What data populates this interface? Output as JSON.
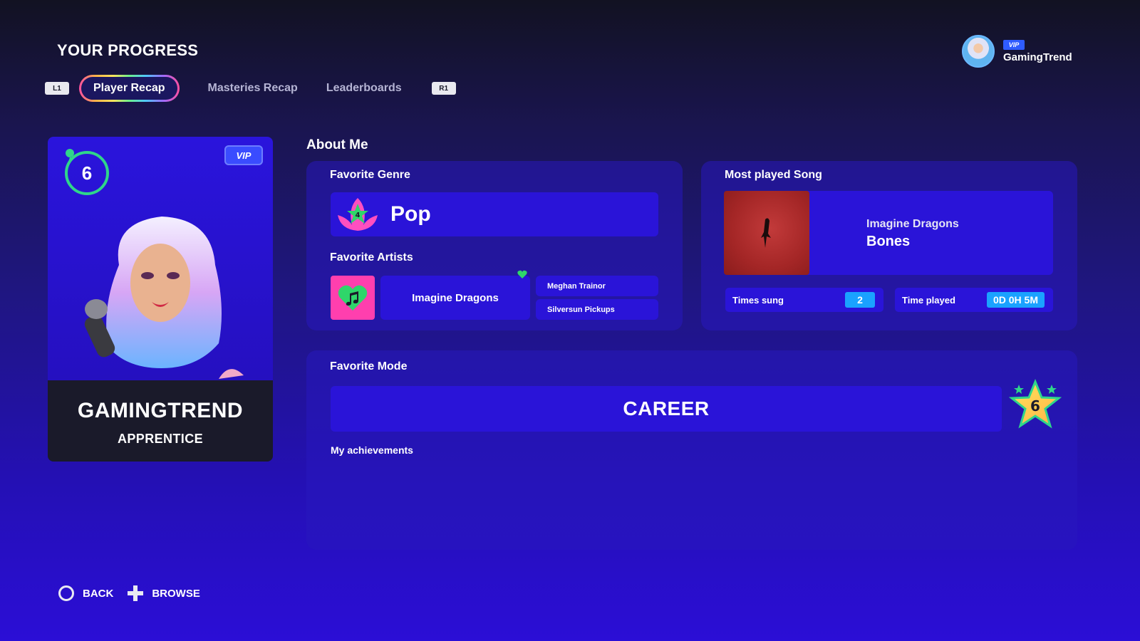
{
  "page": {
    "title": "YOUR PROGRESS"
  },
  "tabs": {
    "left_shoulder": "L1",
    "right_shoulder": "R1",
    "items": [
      {
        "label": "Player Recap",
        "active": true
      },
      {
        "label": "Masteries Recap",
        "active": false
      },
      {
        "label": "Leaderboards",
        "active": false
      }
    ]
  },
  "user": {
    "badge": "VIP",
    "name": "GamingTrend"
  },
  "player_card": {
    "level": "6",
    "badge": "VIP",
    "name": "GAMINGTREND",
    "rank": "APPRENTICE"
  },
  "about": {
    "title": "About Me",
    "favorite_genre": {
      "label": "Favorite Genre",
      "value": "Pop",
      "icon_level": "4"
    },
    "favorite_artists": {
      "label": "Favorite Artists",
      "top": "Imagine Dragons",
      "others": [
        "Meghan Trainor",
        "Silversun Pickups"
      ]
    },
    "most_played_song": {
      "label": "Most played Song",
      "artist": "Imagine Dragons",
      "title": "Bones",
      "times_sung_label": "Times sung",
      "times_sung": "2",
      "time_played_label": "Time played",
      "time_played": "0D 0H 5M"
    }
  },
  "favorite_mode": {
    "label": "Favorite Mode",
    "value": "CAREER",
    "star_level": "6",
    "achievements_label": "My achievements"
  },
  "footer": {
    "back": "BACK",
    "browse": "BROWSE"
  },
  "colors": {
    "accent_green": "#2fd68a",
    "panel_blue": "#2a14d8",
    "stat_blue": "#1aa2ff",
    "pink": "#ff3fae"
  }
}
